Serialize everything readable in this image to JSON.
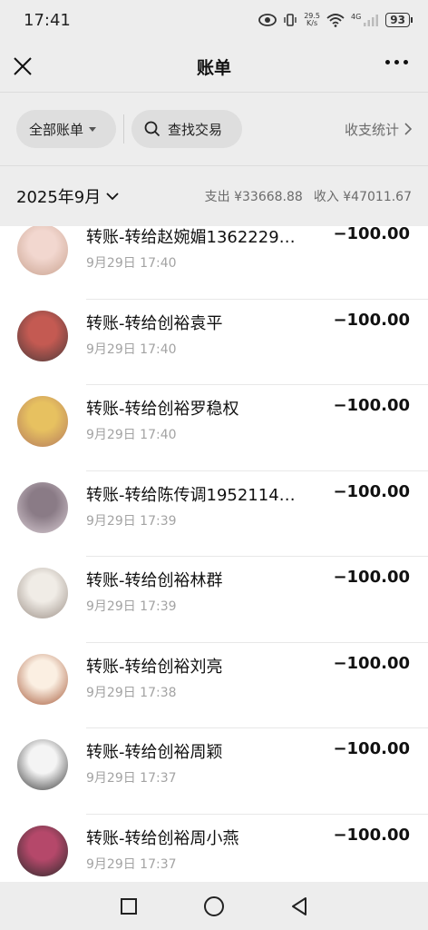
{
  "status": {
    "time": "17:41",
    "net_speed_value": "29.5",
    "net_speed_unit": "K/s",
    "network": "4G",
    "battery": "93"
  },
  "nav": {
    "title": "账单"
  },
  "filters": {
    "all_bills": "全部账单",
    "search": "查找交易",
    "stats": "收支统计"
  },
  "month": {
    "label": "2025年9月",
    "expense": "支出 ¥33668.88",
    "income": "收入 ¥47011.67"
  },
  "transactions": [
    {
      "title": "转账-转给赵婉媚1362229…",
      "time": "9月29日 17:40",
      "amount": "−100.00",
      "avatar_colors": [
        "#f2d7cf",
        "#c9a28f"
      ]
    },
    {
      "title": "转账-转给创裕袁平",
      "time": "9月29日 17:40",
      "amount": "−100.00",
      "avatar_colors": [
        "#c45a52",
        "#4c3a3a"
      ]
    },
    {
      "title": "转账-转给创裕罗稳权",
      "time": "9月29日 17:40",
      "amount": "−100.00",
      "avatar_colors": [
        "#e7c160",
        "#b47a5e"
      ]
    },
    {
      "title": "转账-转给陈传调1952114…",
      "time": "9月29日 17:39",
      "amount": "−100.00",
      "avatar_colors": [
        "#8a7b86",
        "#d8ccd3"
      ]
    },
    {
      "title": "转账-转给创裕林群",
      "time": "9月29日 17:39",
      "amount": "−100.00",
      "avatar_colors": [
        "#f0ece6",
        "#9b8f86"
      ]
    },
    {
      "title": "转账-转给创裕刘亮",
      "time": "9月29日 17:38",
      "amount": "−100.00",
      "avatar_colors": [
        "#fbefe2",
        "#a65a3a"
      ]
    },
    {
      "title": "转账-转给创裕周颖",
      "time": "9月29日 17:37",
      "amount": "−100.00",
      "avatar_colors": [
        "#f4f4f4",
        "#3a3a3a"
      ]
    },
    {
      "title": "转账-转给创裕周小燕",
      "time": "9月29日 17:37",
      "amount": "−100.00",
      "avatar_colors": [
        "#b5486a",
        "#2b2b2b"
      ]
    }
  ]
}
